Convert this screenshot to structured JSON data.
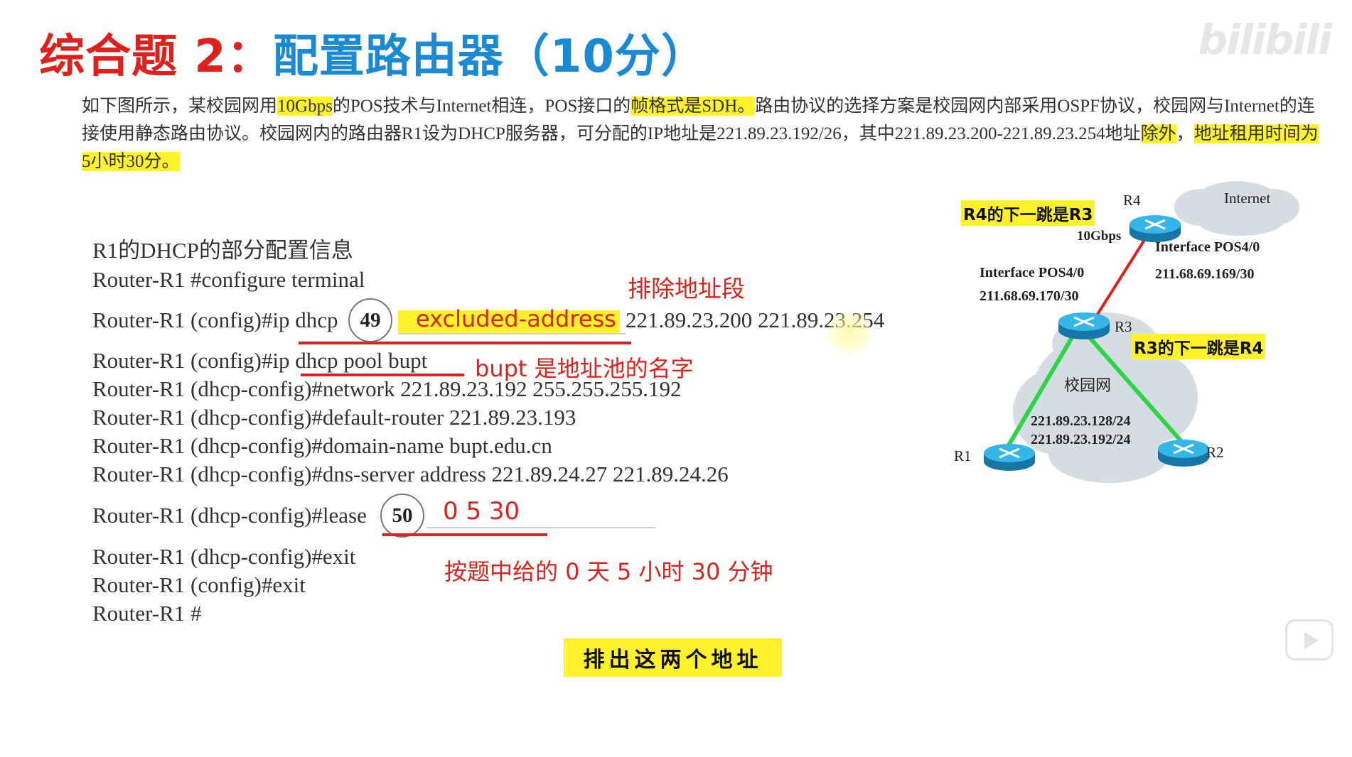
{
  "title": {
    "part1": "综合题 2：",
    "part2": "配置路由器（10分）"
  },
  "watermark": "bilibili",
  "description": {
    "s1": "如下图所示，某校园网用",
    "h1": "10Gbps",
    "s2": "的POS技术与Internet相连，POS接口的",
    "h2": "帧格式是SDH。",
    "s3": "路由协议的选择方案是校园网内部采用OSPF协议，校园网与Internet的连接使用静态路由协议。校园网内的路由器R1设为DHCP服务器，可分配的IP地址是221.89.23.192/26，其中221.89.23.200-221.89.23.254地址",
    "h3": "除外",
    "s4": "，",
    "h4": "地址租用时间为5小时30分。"
  },
  "config": {
    "heading": "R1的DHCP的部分配置信息",
    "line1": "Router-R1 #configure terminal",
    "line2_prefix": "Router-R1 (config)#ip dhcp",
    "blank49": "49",
    "answer49": "excluded-address",
    "line2_suffix": "221.89.23.200 221.89.23.254",
    "line3": "Router-R1 (config)#ip dhcp pool bupt",
    "line4": "Router-R1 (dhcp-config)#network 221.89.23.192 255.255.255.192",
    "line5": "Router-R1 (dhcp-config)#default-router 221.89.23.193",
    "line6": "Router-R1 (dhcp-config)#domain-name bupt.edu.cn",
    "line7": "Router-R1 (dhcp-config)#dns-server address 221.89.24.27 221.89.24.26",
    "line8_prefix": "Router-R1 (dhcp-config)#lease",
    "blank50": "50",
    "answer50": "0 5 30",
    "line9": "Router-R1 (dhcp-config)#exit",
    "line10": "Router-R1 (config)#exit",
    "line11": "Router-R1 #"
  },
  "annotations": {
    "exclude_range": "排除地址段",
    "pool_name": "bupt 是地址池的名字",
    "lease_note": "按题中给的 0 天 5 小时 30 分钟",
    "yellow_note": "排出这两个地址"
  },
  "diagram": {
    "internet": "Internet",
    "r4": "R4",
    "r3": "R3",
    "r1": "R1",
    "r2": "R2",
    "speed": "10Gbps",
    "r3_if_name": "Interface POS4/0",
    "r3_if_ip": "211.68.69.170/30",
    "r4_if_name": "Interface POS4/0",
    "r4_if_ip": "211.68.69.169/30",
    "campus": "校园网",
    "net1": "221.89.23.128/24",
    "net2": "221.89.23.192/24",
    "note_r4": "R4的下一跳是R3",
    "note_r3": "R3的下一跳是R4"
  },
  "colors": {
    "title_red": "#e0211b",
    "title_blue": "#1a8ad4",
    "highlight": "#fff22a",
    "link_red": "#e0211b",
    "link_green": "#2bd645",
    "router_blue": "#1ea0d8",
    "cloud_grey": "#d6dde2"
  }
}
